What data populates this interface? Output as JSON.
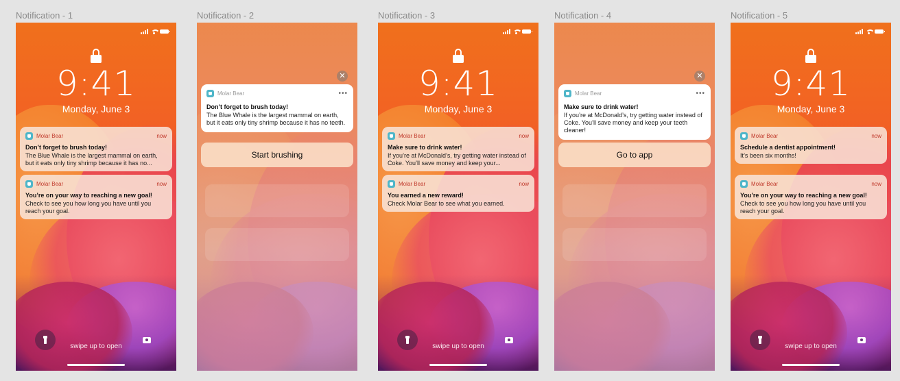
{
  "frames": [
    {
      "label": "Notification - 1",
      "time": "9:41",
      "date": "Monday, June 3",
      "notifications": [
        {
          "app": "Molar Bear",
          "time": "now",
          "title": "Don’t forget to brush today!",
          "body": "The Blue Whale is the largest mammal on earth, but it eats only tiny shrimp because it has no..."
        },
        {
          "app": "Molar Bear",
          "time": "now",
          "title": "You’re on your way to reaching a new goal!",
          "body": "Check to see you how long you have until you reach your goal."
        }
      ],
      "swipe": "swipe up to open"
    },
    {
      "label": "Notification - 2",
      "card": {
        "app": "Molar Bear",
        "title": "Don’t forget to brush today!",
        "body": "The Blue Whale is the largest mammal on earth, but it eats only tiny shrimp because it has no teeth."
      },
      "action": "Start brushing",
      "close": "✕",
      "more": "•••"
    },
    {
      "label": "Notification - 3",
      "time": "9:41",
      "date": "Monday, June 3",
      "notifications": [
        {
          "app": "Molar Bear",
          "time": "now",
          "title": "Make sure to drink water!",
          "body": "If you’re at McDonald’s, try getting water instead of Coke. You’ll save money and keep your..."
        },
        {
          "app": "Molar Bear",
          "time": "now",
          "title": "You earned a new reward!",
          "body": "Check Molar Bear to see what you earned."
        }
      ],
      "swipe": "swipe up to open"
    },
    {
      "label": "Notification - 4",
      "card": {
        "app": "Molar Bear",
        "title": "Make sure to drink water!",
        "body": "If you’re at McDonald’s, try getting water instead of Coke. You’ll save money and keep your teeth cleaner!"
      },
      "action": "Go to app",
      "close": "✕",
      "more": "•••"
    },
    {
      "label": "Notification - 5",
      "time": "9:41",
      "date": "Monday, June 3",
      "notifications": [
        {
          "app": "Molar Bear",
          "time": "now",
          "title": "Schedule a dentist appointment!",
          "body": "It’s been six months!"
        },
        {
          "app": "Molar Bear",
          "time": "now",
          "title": "You’re on your way to reaching a new goal!",
          "body": "Check to see you how long you have until you reach your goal."
        }
      ],
      "swipe": "swipe up to open"
    }
  ]
}
